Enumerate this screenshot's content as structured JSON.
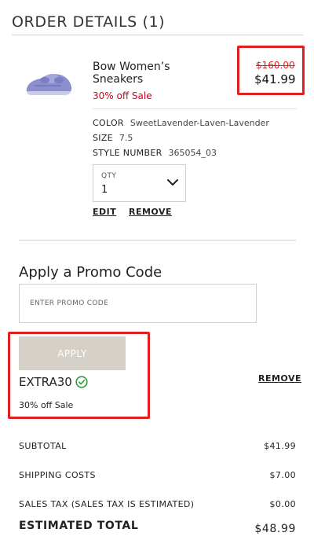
{
  "order": {
    "title": "ORDER DETAILS (1)"
  },
  "product": {
    "name": "Bow Women’s Sneakers",
    "sale_label": "30% off Sale",
    "old_price": "$160.00",
    "new_price": "$41.99",
    "image_icon": "sneaker-icon",
    "attributes": {
      "color_label": "COLOR",
      "color_value": "SweetLavender-Laven-Lavender",
      "size_label": "SIZE",
      "size_value": "7.5",
      "style_label": "STYLE NUMBER",
      "style_value": "365054_03"
    },
    "qty_label": "QTY",
    "qty_value": "1",
    "edit_label": "EDIT",
    "remove_label": "REMOVE"
  },
  "promo": {
    "heading": "Apply a Promo Code",
    "placeholder": "ENTER PROMO CODE",
    "apply_label": "APPLY",
    "code": "EXTRA30",
    "code_desc": "30% off Sale",
    "remove_label": "REMOVE"
  },
  "summary": {
    "subtotal_label": "SUBTOTAL",
    "subtotal_value": "$41.99",
    "shipping_label": "SHIPPING COSTS",
    "shipping_value": "$7.00",
    "tax_label": "SALES TAX (SALES TAX IS ESTIMATED)",
    "tax_value": "$0.00",
    "total_label": "ESTIMATED TOTAL",
    "total_value": "$48.99"
  },
  "colors": {
    "sale_red": "#d5001c",
    "highlight_red": "#e21f1f",
    "apply_button": "#d5d0c8",
    "check_green": "#2e9a3e",
    "product_lavender": "#8c8fcf"
  }
}
